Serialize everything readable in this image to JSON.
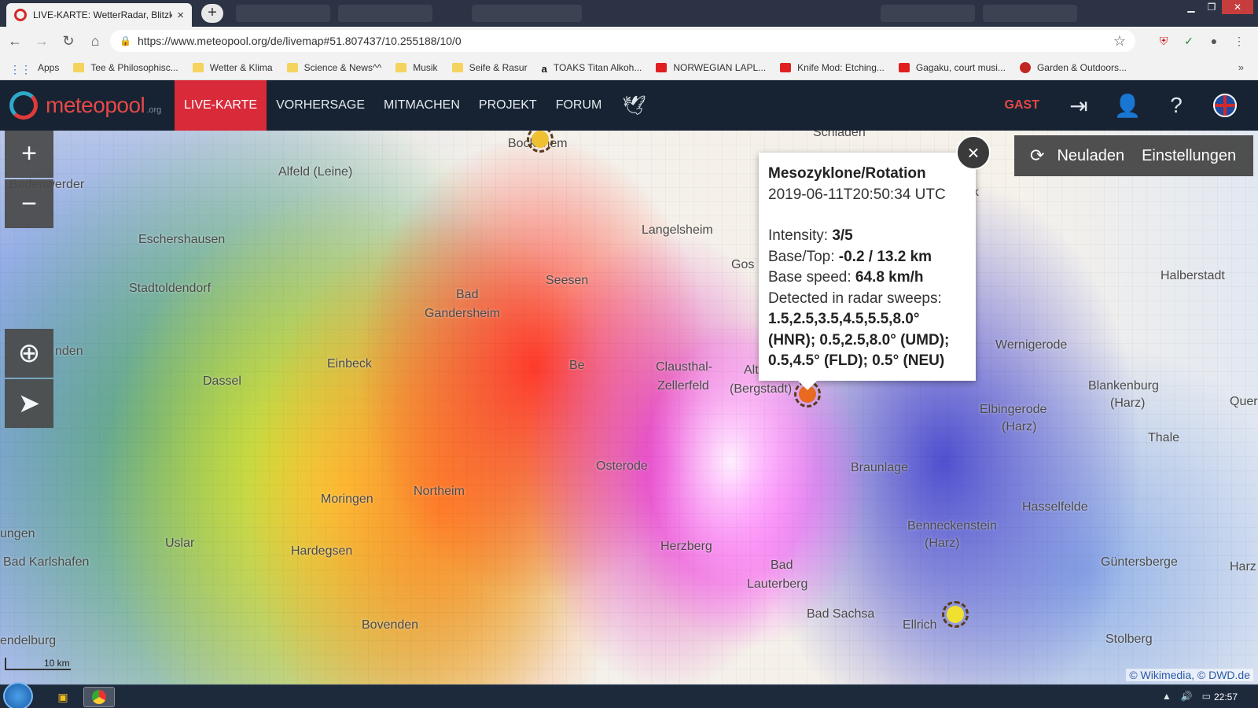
{
  "browser": {
    "tab_title": "LIVE-KARTE: WetterRadar, Blitzka",
    "url": "https://www.meteopool.org/de/livemap#51.807437/10.255188/10/0",
    "new_tab_label": "+",
    "close_tab": "×"
  },
  "bookmarks": [
    {
      "label": "Apps",
      "icon": "apps-grid-icon"
    },
    {
      "label": "Tee & Philosophisc...",
      "icon": "folder-icon"
    },
    {
      "label": "Wetter & Klima",
      "icon": "folder-icon"
    },
    {
      "label": "Science & News^^",
      "icon": "folder-icon"
    },
    {
      "label": "Musik",
      "icon": "folder-icon"
    },
    {
      "label": "Seife & Rasur",
      "icon": "folder-icon"
    },
    {
      "label": "TOAKS Titan Alkoh...",
      "icon": "amazon-icon"
    },
    {
      "label": "NORWEGIAN LAPL...",
      "icon": "youtube-icon"
    },
    {
      "label": "Knife Mod: Etching...",
      "icon": "youtube-icon"
    },
    {
      "label": "Gagaku, court musi...",
      "icon": "youtube-icon"
    },
    {
      "label": "Garden & Outdoors...",
      "icon": "pinterest-icon"
    }
  ],
  "site": {
    "logo_name": "meteopool",
    "logo_org": ".org",
    "nav": [
      "LIVE-KARTE",
      "VORHERSAGE",
      "MITMACHEN",
      "PROJEKT",
      "FORUM"
    ],
    "user_label": "GAST"
  },
  "map": {
    "reload_label": "Neuladen",
    "settings_label": "Einstellungen",
    "zoom_in": "+",
    "zoom_out": "−",
    "scale_label": "10 km",
    "attribution": "© Wikimedia, © DWD.de",
    "places": [
      "Schladen",
      "Bodenwerder",
      "Alfeld (Leine)",
      "Eschershausen",
      "Langelsheim",
      "Gos",
      "Halberstadt",
      "Stadtoldendorf",
      "Seesen",
      "Bad",
      "Gandersheim",
      "nden",
      "Einbeck",
      "Be",
      "Clausthal-",
      "Zellerfeld",
      "Alt",
      "(Bergstadt)",
      "Wernigerode",
      "Dassel",
      "Blankenburg",
      "(Harz)",
      "Elbingerode",
      "(Harz)",
      "Quer",
      "Thale",
      "Osterode",
      "Braunlage",
      "Moringen",
      "Northeim",
      "Hasselfelde",
      "ungen",
      "Benneckenstein",
      "(Harz)",
      "Uslar",
      "Hardegsen",
      "Herzberg",
      "Bad",
      "Lauterberg",
      "Güntersberge",
      "Harz",
      "Bad Karlshafen",
      "Bad Sachsa",
      "Ellrich",
      "Bovenden",
      "endelburg",
      "Stolberg",
      "Bockenem",
      "eck"
    ]
  },
  "popup": {
    "title": "Mesozyklone/Rotation",
    "timestamp": "2019-06-11T20:50:34 UTC",
    "intensity_label": "Intensity:",
    "intensity_value": "3/5",
    "basetop_label": "Base/Top:",
    "basetop_value": "-0.2 / 13.2 km",
    "speed_label": "Base speed:",
    "speed_value": "64.8 km/h",
    "sweeps_label": "Detected in radar sweeps:",
    "sweeps_line1": "1.5,2.5,3.5,4.5,5.5,8.0°",
    "sweeps_line2": "(HNR); 0.5,2.5,8.0° (UMD);",
    "sweeps_line3": "0.5,4.5° (FLD); 0.5° (NEU)",
    "close": "×"
  },
  "taskbar": {
    "clock": "22:57"
  },
  "colors": {
    "accent": "#d92a3a",
    "nav_bg": "#172332",
    "logo_red": "#e64848"
  }
}
